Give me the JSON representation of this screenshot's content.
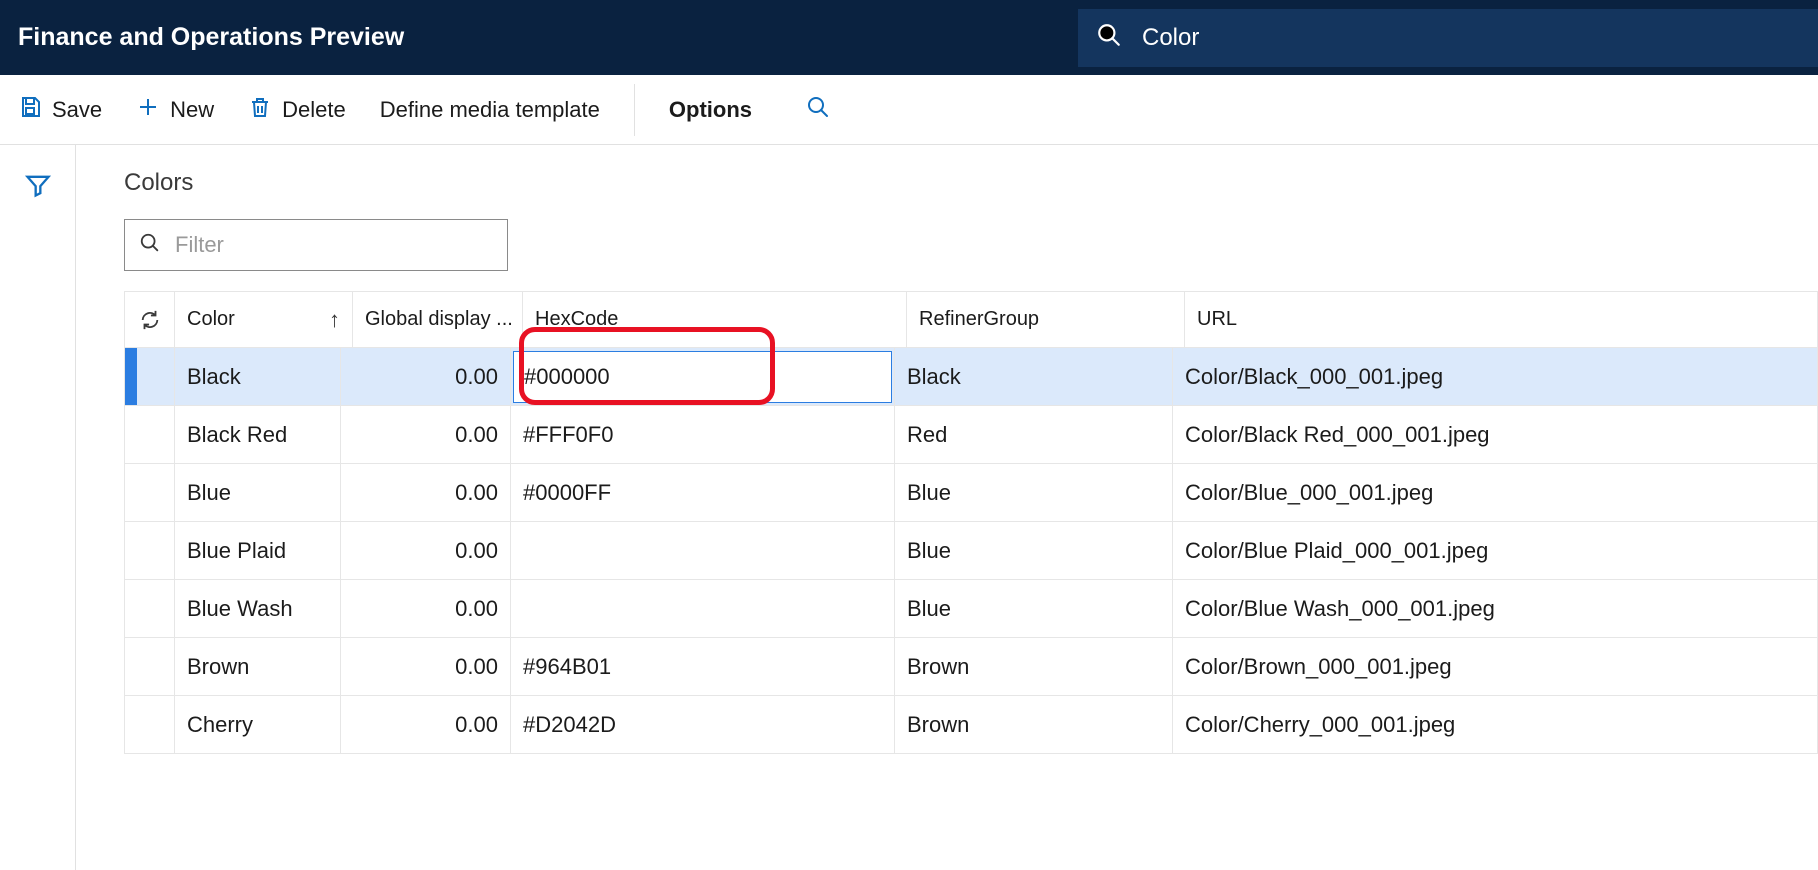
{
  "nav": {
    "title": "Finance and Operations Preview",
    "search": "Color"
  },
  "actions": {
    "save": "Save",
    "new": "New",
    "delete": "Delete",
    "define_media": "Define media template",
    "options": "Options"
  },
  "page": {
    "title": "Colors",
    "filter_placeholder": "Filter"
  },
  "columns": {
    "color": "Color",
    "global_display": "Global display ...",
    "hex": "HexCode",
    "refiner": "RefinerGroup",
    "url": "URL"
  },
  "rows": [
    {
      "color": "Black",
      "global": "0.00",
      "hex": "#000000",
      "refiner": "Black",
      "url": "Color/Black_000_001.jpeg",
      "selected": true,
      "editing": true
    },
    {
      "color": "Black Red",
      "global": "0.00",
      "hex": "#FFF0F0",
      "refiner": "Red",
      "url": "Color/Black Red_000_001.jpeg",
      "selected": false,
      "editing": false
    },
    {
      "color": "Blue",
      "global": "0.00",
      "hex": "#0000FF",
      "refiner": "Blue",
      "url": "Color/Blue_000_001.jpeg",
      "selected": false,
      "editing": false
    },
    {
      "color": "Blue Plaid",
      "global": "0.00",
      "hex": "",
      "refiner": "Blue",
      "url": "Color/Blue Plaid_000_001.jpeg",
      "selected": false,
      "editing": false
    },
    {
      "color": "Blue Wash",
      "global": "0.00",
      "hex": "",
      "refiner": "Blue",
      "url": "Color/Blue Wash_000_001.jpeg",
      "selected": false,
      "editing": false
    },
    {
      "color": "Brown",
      "global": "0.00",
      "hex": "#964B01",
      "refiner": "Brown",
      "url": "Color/Brown_000_001.jpeg",
      "selected": false,
      "editing": false
    },
    {
      "color": "Cherry",
      "global": "0.00",
      "hex": "#D2042D",
      "refiner": "Brown",
      "url": "Color/Cherry_000_001.jpeg",
      "selected": false,
      "editing": false
    }
  ]
}
